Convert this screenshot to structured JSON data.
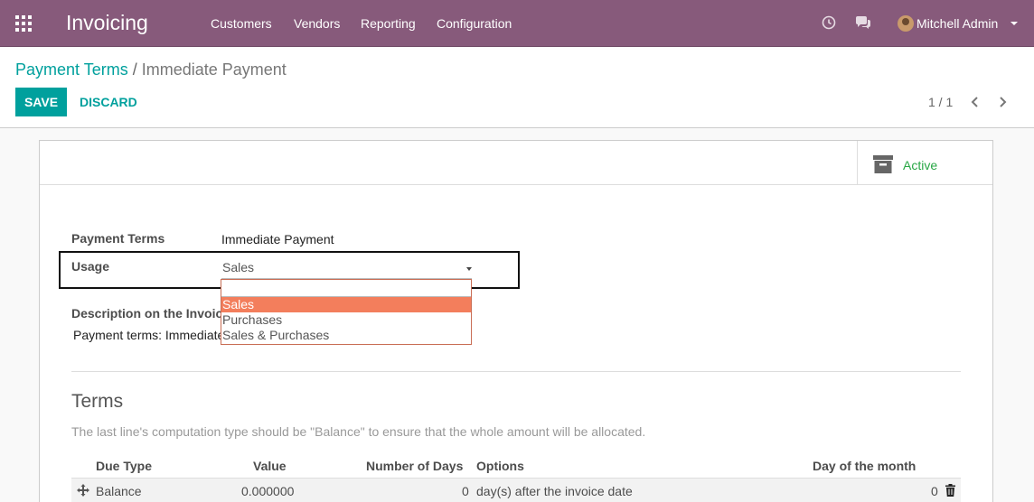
{
  "navbar": {
    "app_title": "Invoicing",
    "menu": [
      "Customers",
      "Vendors",
      "Reporting",
      "Configuration"
    ],
    "user_name": "Mitchell Admin",
    "icons": [
      "apps-grid-icon",
      "clock-icon",
      "chat-icon",
      "avatar"
    ]
  },
  "control": {
    "breadcrumb_parent": "Payment Terms",
    "breadcrumb_separator": "/",
    "breadcrumb_current": "Immediate Payment",
    "save_label": "SAVE",
    "discard_label": "DISCARD",
    "pager": "1 / 1"
  },
  "form": {
    "active_label": "Active",
    "payment_terms_label": "Payment Terms",
    "payment_terms_value": "Immediate Payment",
    "usage_label": "Usage",
    "usage_value": "Sales",
    "usage_options": [
      "Sales",
      "Purchases",
      "Sales & Purchases"
    ],
    "usage_selected_index": 0,
    "description_label": "Description on the Invoice",
    "description_value": "Payment terms: Immediate Payment"
  },
  "terms": {
    "title": "Terms",
    "help": "The last line's computation type should be \"Balance\" to ensure that the whole amount will be allocated.",
    "columns": [
      "Due Type",
      "Value",
      "Number of Days",
      "Options",
      "Day of the month"
    ],
    "rows": [
      {
        "due_type": "Balance",
        "value": "0.000000",
        "days": "0",
        "options": "day(s) after the invoice date",
        "day_of_month": "0"
      }
    ]
  },
  "colors": {
    "navbar": "#875a7b",
    "primary": "#00a09d",
    "active_green": "#28a745",
    "dropdown_highlight": "#f37e5c"
  }
}
